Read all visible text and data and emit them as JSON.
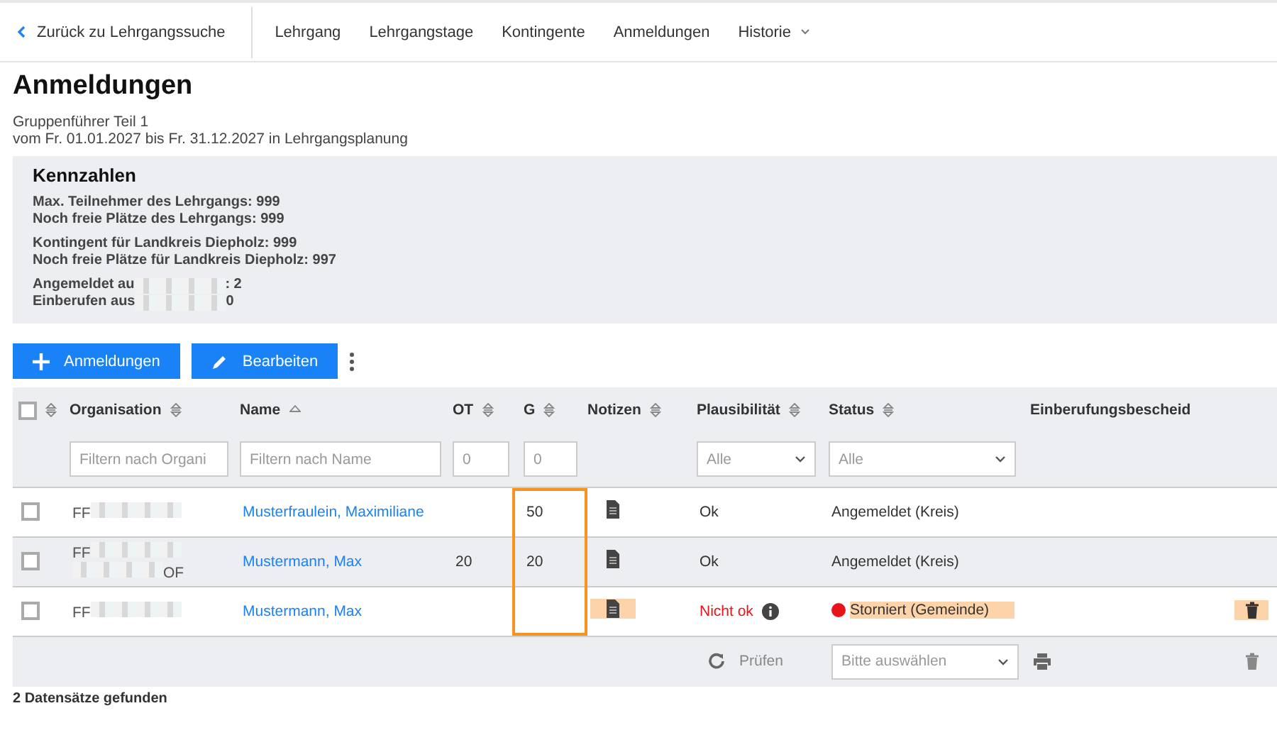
{
  "nav": {
    "back": "Zurück zu Lehrgangssuche",
    "items": [
      {
        "label": "Lehrgang",
        "dropdown": false
      },
      {
        "label": "Lehrgangstage",
        "dropdown": false
      },
      {
        "label": "Kontingente",
        "dropdown": false
      },
      {
        "label": "Anmeldungen",
        "dropdown": false
      },
      {
        "label": "Historie",
        "dropdown": true
      }
    ]
  },
  "page": {
    "title": "Anmeldungen",
    "subtitle": [
      "Gruppenführer Teil 1",
      "vom Fr. 01.01.2027 bis Fr. 31.12.2027 in Lehrgangsplanung"
    ]
  },
  "kennzahlen": {
    "title": "Kennzahlen",
    "groups": [
      [
        [
          {
            "kind": "text",
            "text": "Max. Teilnehmer des Lehrgangs: 999"
          }
        ],
        [
          {
            "kind": "text",
            "text": "Noch freie Plätze des Lehrgangs: 999"
          }
        ]
      ],
      [
        [
          {
            "kind": "text",
            "text": "Kontingent für Landkreis Diepholz: 999"
          }
        ],
        [
          {
            "kind": "text",
            "text": "Noch freie Plätze für Landkreis Diepholz: 997"
          }
        ]
      ],
      [
        [
          {
            "kind": "text",
            "text": "Angemeldet au"
          },
          {
            "kind": "redacted"
          },
          {
            "kind": "text",
            "text": ": 2"
          }
        ],
        [
          {
            "kind": "text",
            "text": "Einberufen aus"
          },
          {
            "kind": "redacted"
          },
          {
            "kind": "text",
            "text": "0"
          }
        ]
      ]
    ]
  },
  "actions": [
    {
      "label": "Anmeldungen"
    },
    {
      "label": "Bearbeiten"
    }
  ],
  "table": {
    "columns": [
      {
        "sortable": true,
        "sorted_ascending": false,
        "filter": {
          "kind": "checkbox",
          "checked": false
        },
        "outlined": false
      },
      {
        "label": "Organisation",
        "sortable": true,
        "sorted_ascending": false,
        "filter": {
          "kind": "text",
          "placeholder": "Filtern nach Organi"
        },
        "outlined": false
      },
      {
        "label": "Name",
        "sortable": true,
        "sorted_ascending": true,
        "filter": {
          "kind": "text",
          "placeholder": "Filtern nach Name"
        },
        "outlined": false
      },
      {
        "label": "OT",
        "sortable": true,
        "sorted_ascending": false,
        "filter": {
          "kind": "text",
          "placeholder": "0"
        },
        "outlined": false
      },
      {
        "label": "G",
        "sortable": true,
        "sorted_ascending": false,
        "filter": {
          "kind": "text",
          "placeholder": "0"
        },
        "outlined": true
      },
      {
        "label": "Notizen",
        "sortable": true,
        "sorted_ascending": false,
        "filter": {
          "kind": "none"
        },
        "outlined": false
      },
      {
        "label": "Plausibilität",
        "sortable": true,
        "sorted_ascending": false,
        "filter": {
          "kind": "select",
          "placeholder": "Alle"
        },
        "outlined": false
      },
      {
        "label": "Status",
        "sortable": true,
        "sorted_ascending": false,
        "filter": {
          "kind": "select",
          "placeholder": "Alle"
        },
        "outlined": false
      },
      {
        "label": "Einberufungsbescheid",
        "sortable": false,
        "filter": {
          "kind": "none"
        },
        "outlined": false
      }
    ],
    "rows": [
      {
        "checked": false,
        "organisation": [
          {
            "kind": "text",
            "text": "FF"
          },
          {
            "kind": "redacted"
          }
        ],
        "name": "Musterfraulein, Maximiliane",
        "g": "50",
        "notes_highlighted": false,
        "plausibility": "Ok",
        "plausibility_ok": true,
        "status": "Angemeldet (Kreis)",
        "status_highlighted": false,
        "delete": false
      },
      {
        "checked": false,
        "organisation": [
          {
            "kind": "text",
            "text": "FF"
          },
          {
            "kind": "redacted"
          },
          {
            "kind": "break"
          },
          {
            "kind": "redacted"
          },
          {
            "kind": "text",
            "text": "OF"
          }
        ],
        "name": "Mustermann, Max",
        "ot": "20",
        "g": "20",
        "notes_highlighted": false,
        "plausibility": "Ok",
        "plausibility_ok": true,
        "status": "Angemeldet (Kreis)",
        "status_highlighted": false,
        "delete": false
      },
      {
        "checked": false,
        "organisation": [
          {
            "kind": "text",
            "text": "FF"
          },
          {
            "kind": "redacted"
          }
        ],
        "name": "Mustermann, Max",
        "notes_highlighted": true,
        "plausibility": "Nicht ok",
        "plausibility_ok": false,
        "status": "Storniert (Gemeinde)",
        "color": "#e8141b",
        "status_highlighted": true,
        "delete": true,
        "delete_highlighted": true
      }
    ],
    "footer": {
      "check": "Prüfen",
      "status_placeholder": "Bitte auswählen"
    }
  },
  "result_count": "2 Datensätze gefunden"
}
